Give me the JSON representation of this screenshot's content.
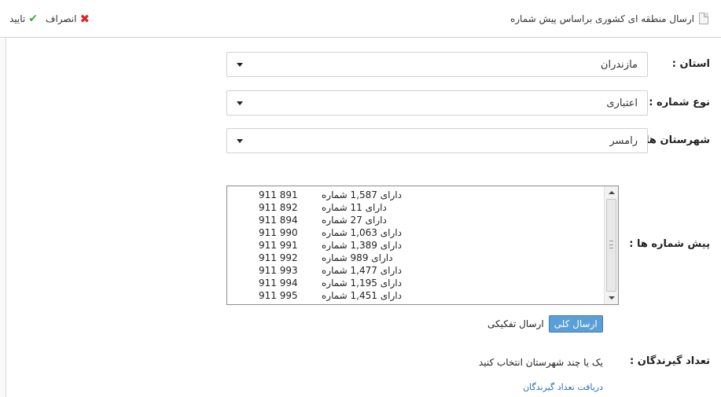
{
  "header": {
    "title": "ارسال منطقه ای کشوری براساس پیش شماره",
    "confirm_label": "تایید",
    "cancel_label": "انصراف",
    "confirm_icon": "check-icon",
    "cancel_icon": "close-x-icon",
    "accent_confirm": "#36b030",
    "accent_cancel": "#d8252a"
  },
  "form": {
    "province": {
      "label": "استان :",
      "value": "مازندران"
    },
    "number_type": {
      "label": "نوع شماره :",
      "value": "اعتباری"
    },
    "cities": {
      "label": "شهرستان ها :",
      "value": "رامسر"
    },
    "prefixes": {
      "label": "پیش شماره ها :",
      "items": [
        {
          "code": "911 891",
          "desc": "دارای 1,587 شماره"
        },
        {
          "code": "911 892",
          "desc": "دارای 11 شماره"
        },
        {
          "code": "911 894",
          "desc": "دارای 27 شماره"
        },
        {
          "code": "911 990",
          "desc": "دارای 1,063 شماره"
        },
        {
          "code": "911 991",
          "desc": "دارای 1,389 شماره"
        },
        {
          "code": "911 992",
          "desc": "دارای 989 شماره"
        },
        {
          "code": "911 993",
          "desc": "دارای 1,477 شماره"
        },
        {
          "code": "911 994",
          "desc": "دارای 1,195 شماره"
        },
        {
          "code": "911 995",
          "desc": "دارای 1,451 شماره"
        }
      ]
    },
    "send_mode": {
      "active": "ارسال کلی",
      "inactive": "ارسال تفکیکی",
      "active_color": "#5b9fd6"
    },
    "recipients": {
      "label": "تعداد گیرندگان :",
      "message": "یک یا چند شهرستان انتخاب کنید",
      "link": "دریافت تعداد گیرندگان"
    }
  }
}
